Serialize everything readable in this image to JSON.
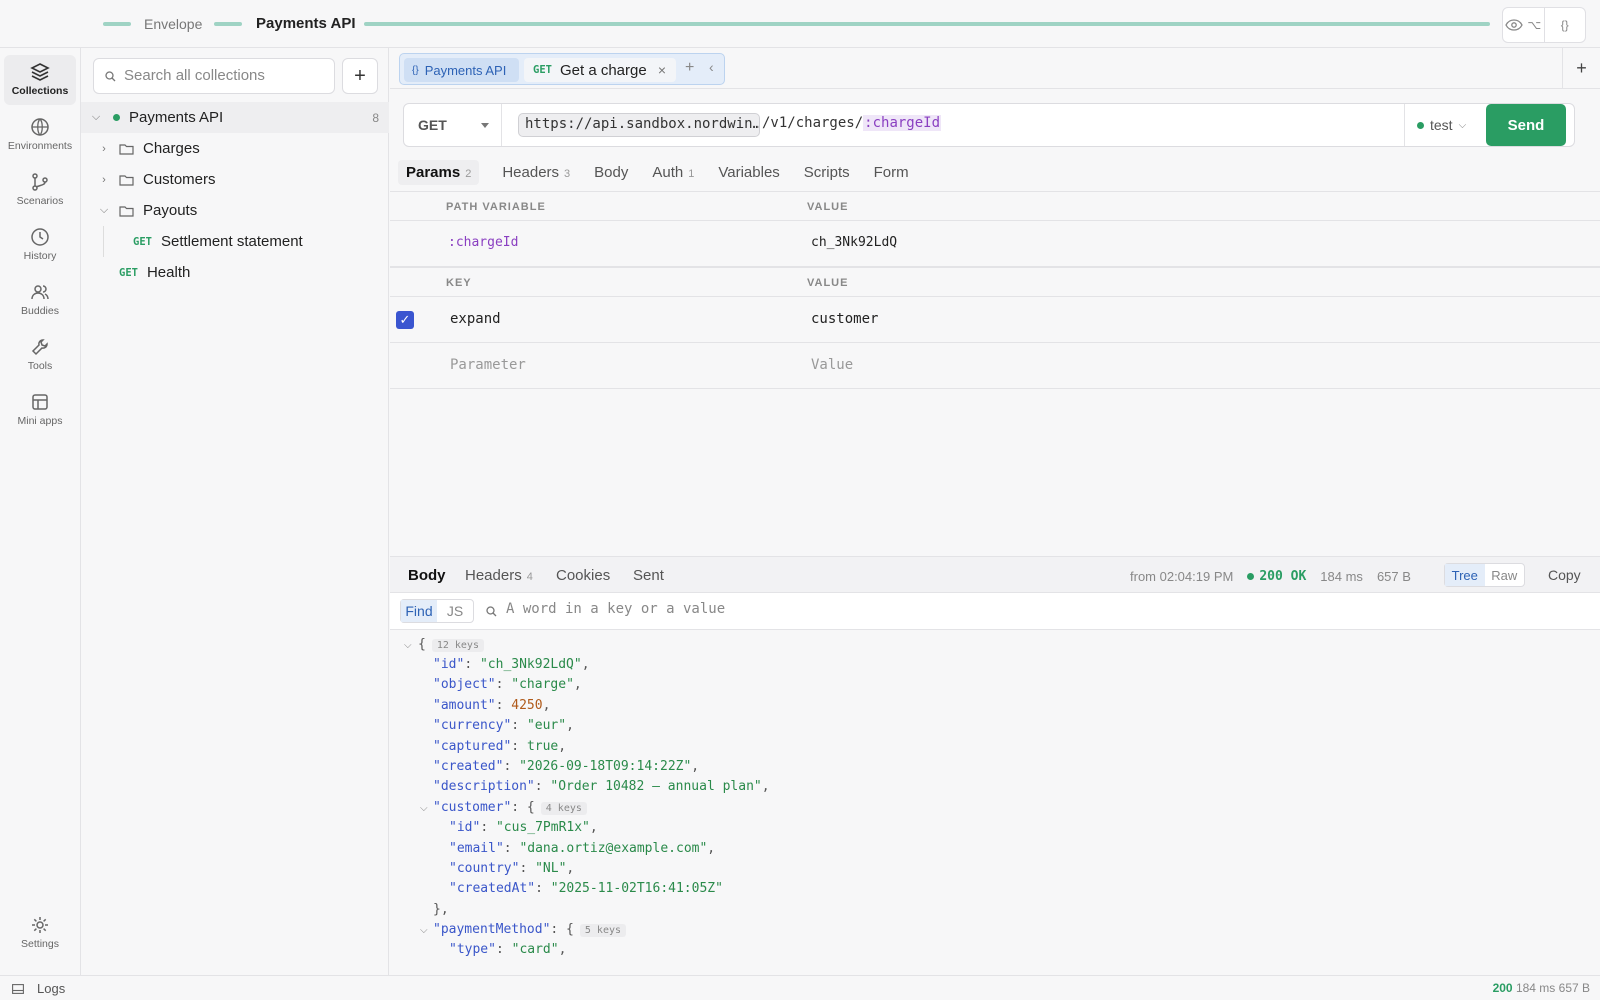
{
  "titlebar": {
    "breadcrumb_parent": "Envelope",
    "title": "Payments API"
  },
  "nav": {
    "items": [
      {
        "label": "Collections",
        "icon": "collections-icon"
      },
      {
        "label": "Environments",
        "icon": "globe-icon"
      },
      {
        "label": "Scenarios",
        "icon": "branch-icon"
      },
      {
        "label": "History",
        "icon": "clock-icon"
      },
      {
        "label": "Buddies",
        "icon": "users-icon"
      },
      {
        "label": "Tools",
        "icon": "wrench-icon"
      },
      {
        "label": "Mini apps",
        "icon": "layout-icon"
      }
    ],
    "settings_label": "Settings"
  },
  "collections": {
    "search_placeholder": "Search all collections",
    "root": {
      "name": "Payments API",
      "count": "8"
    },
    "folders": [
      "Charges",
      "Customers",
      "Payouts"
    ],
    "requests": [
      {
        "method": "GET",
        "name": "Settlement statement"
      },
      {
        "method": "GET",
        "name": "Health"
      }
    ]
  },
  "tabs": {
    "collection_tab": "Payments API",
    "request_method": "GET",
    "request_title": "Get a charge"
  },
  "request": {
    "method": "GET",
    "url_host": "https://api.sandbox.nordwin…",
    "url_path": "/v1/charges/",
    "url_var": ":chargeId",
    "environment": "test",
    "send_label": "Send"
  },
  "request_tabs": [
    {
      "label": "Params",
      "count": "2"
    },
    {
      "label": "Headers",
      "count": "3"
    },
    {
      "label": "Body",
      "count": ""
    },
    {
      "label": "Auth",
      "count": "1"
    },
    {
      "label": "Variables",
      "count": ""
    },
    {
      "label": "Scripts",
      "count": ""
    },
    {
      "label": "Form",
      "count": ""
    }
  ],
  "params": {
    "path_header_key": "PATH VARIABLE",
    "path_header_value": "VALUE",
    "path_var": {
      "key": ":chargeId",
      "value": "ch_3Nk92LdQ"
    },
    "query_header_key": "KEY",
    "query_header_value": "VALUE",
    "query": {
      "key": "expand",
      "value": "customer",
      "checked": true
    },
    "new_key_placeholder": "Parameter",
    "new_value_placeholder": "Value"
  },
  "response": {
    "tabs": [
      {
        "label": "Body",
        "count": ""
      },
      {
        "label": "Headers",
        "count": "4"
      },
      {
        "label": "Cookies",
        "count": ""
      },
      {
        "label": "Sent",
        "count": ""
      }
    ],
    "from_time": "from 02:04:19 PM",
    "status_code": "200 OK",
    "time": "184 ms",
    "size": "657 B",
    "view_tree": "Tree",
    "view_raw": "Raw",
    "copy_label": "Copy",
    "find_label": "Find",
    "js_label": "JS",
    "find_placeholder": "A word in a key or a value",
    "json_lines": [
      "{",
      "12 keys",
      "\"id\"",
      "\"ch_3Nk92LdQ\"",
      "\"object\"",
      "\"charge\"",
      "\"amount\"",
      "4250",
      "\"currency\"",
      "\"eur\"",
      "\"captured\"",
      "true",
      "\"created\"",
      "\"2026-09-18T09:14:22Z\"",
      "\"description\"",
      "\"Order 10482 — annual plan\"",
      "\"customer\"",
      "4 keys",
      "\"id\"",
      "\"cus_7PmR1x\"",
      "\"email\"",
      "\"dana.ortiz@example.com\"",
      "\"country\"",
      "\"NL\"",
      "\"createdAt\"",
      "\"2025-11-02T16:41:05Z\"",
      "},",
      "\"paymentMethod\"",
      "5 keys",
      "\"type\"",
      "\"card\""
    ]
  },
  "statusbar": {
    "logs_label": "Logs",
    "code": "200",
    "time": "184 ms",
    "size": "657 B"
  }
}
